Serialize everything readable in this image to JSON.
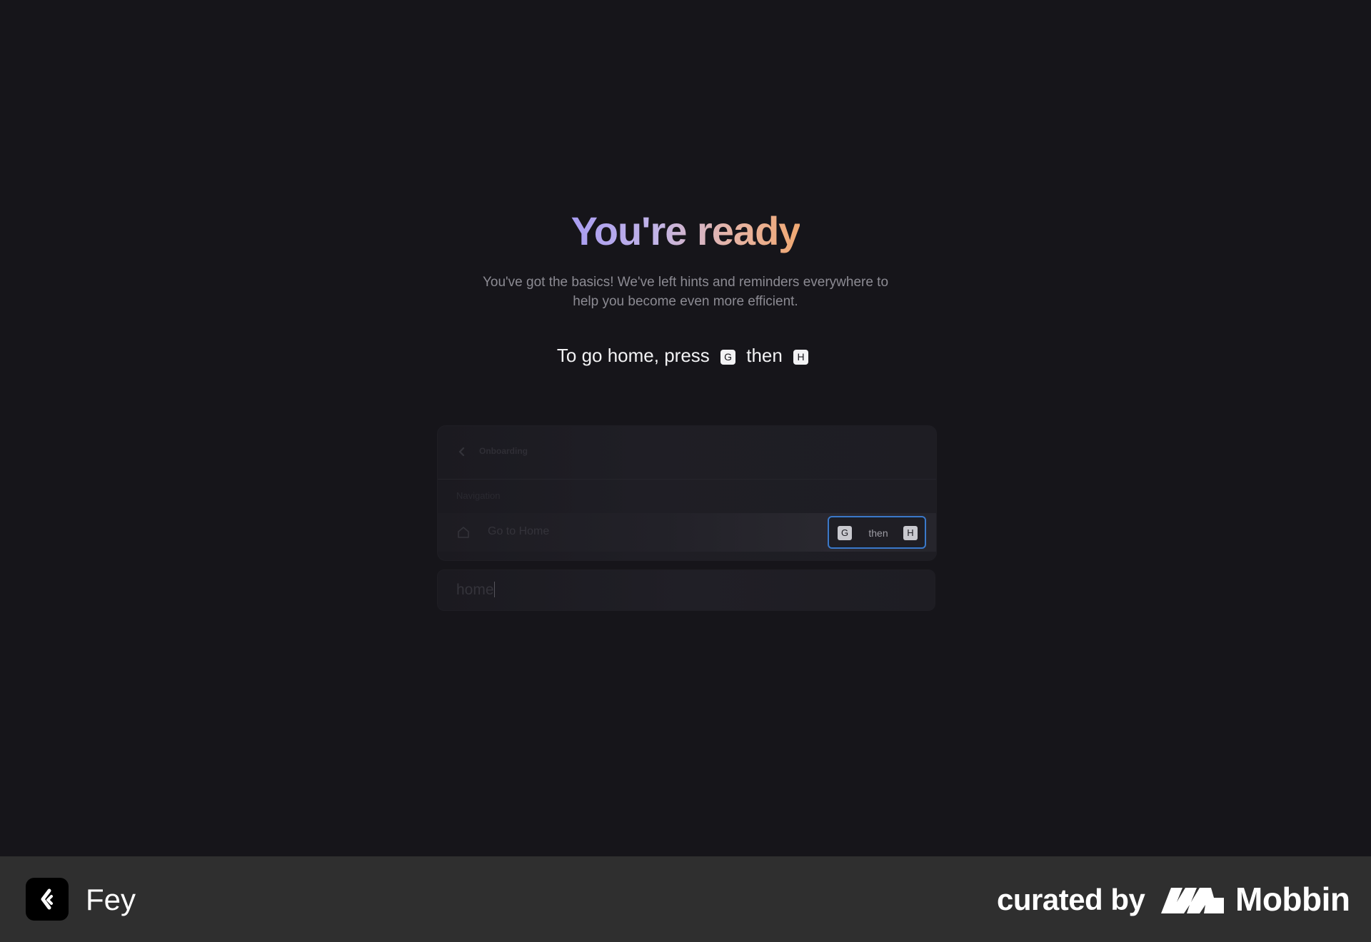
{
  "onboarding": {
    "title": "You're ready",
    "subtitle": "You've got the basics! We've left hints and reminders everywhere to help you become even more efficient.",
    "instruction": {
      "prefix": "To go home, press",
      "key1": "G",
      "then": "then",
      "key2": "H"
    }
  },
  "palette": {
    "breadcrumb": "Onboarding",
    "section_label": "Navigation",
    "row": {
      "icon": "home-icon",
      "label": "Go to Home",
      "shortcut": {
        "key1": "G",
        "then": "then",
        "key2": "H"
      }
    },
    "search": {
      "value": "home"
    }
  },
  "footer": {
    "app_name": "Fey",
    "curated_by": "curated by",
    "brand": "Mobbin"
  },
  "colors": {
    "background": "#16151a",
    "footer": "#2f2f2f",
    "focus_ring": "#3c78c8",
    "title_gradient_start": "#a99df2",
    "title_gradient_end": "#f0a872"
  }
}
